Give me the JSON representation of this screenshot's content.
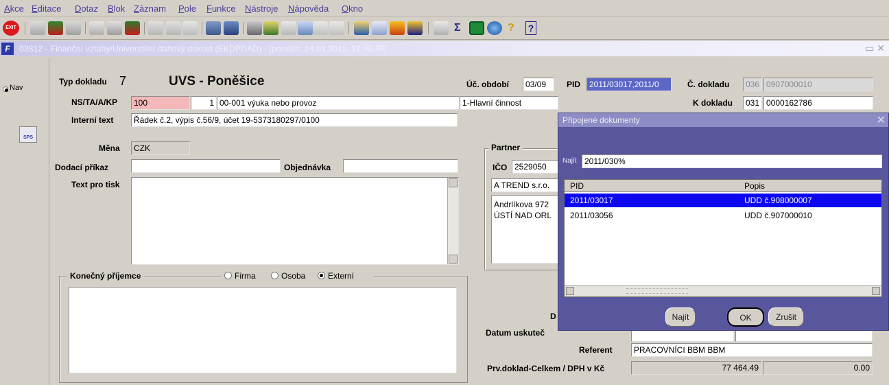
{
  "menu": [
    "Akce",
    "Editace",
    "Dotaz",
    "Blok",
    "Záznam",
    "Pole",
    "Funkce",
    "Nástroje",
    "Nápověda",
    "Okno"
  ],
  "toolbar": {
    "exit_label": "EXIT",
    "icons": [
      "exit-icon",
      "back-icon",
      "save-icon",
      "forward-icon",
      "copy-record-icon",
      "new-record-icon",
      "delete-record-icon",
      "sort-asc-icon",
      "sort-desc-icon",
      "filter-icon",
      "print-icon",
      "print-preview-icon",
      "cut-icon",
      "insert-icon",
      "paste-icon",
      "query-icon",
      "list-icon",
      "tree-icon",
      "export-icon",
      "document-icon",
      "star-icon",
      "warning-icon",
      "calculator-icon",
      "sum-icon",
      "excel-icon",
      "globe-icon",
      "help-icon",
      "context-help-icon"
    ],
    "sum_glyph": "Σ",
    "help_glyph": "?"
  },
  "window": {
    "title": "03812 - Finanční vztahy/Univerzální daňový doklad (EKDPDAD) - [pondělí, 24.01.2011, 12:45:36]",
    "controls": "▭ ✕"
  },
  "leftnav": {
    "nav_label": "Nav",
    "sps_label": "SPS"
  },
  "form": {
    "typ_dokladu_label": "Typ dokladu",
    "typ_dokladu_value": "7",
    "company": "UVS - Poněšice",
    "obdobi_label": "Úč. období",
    "obdobi_value": "03/09",
    "pid_label": "PID",
    "pid_value": "2011/03017,2011/0",
    "cdokladu_label": "Č. dokladu",
    "cdokladu_a": "036",
    "cdokladu_b": "0907000010",
    "ns_label": "NS/TA/A/KP",
    "ns_value": "100",
    "ta_num": "1",
    "ta_text": "00-001 výuka nebo provoz",
    "cinnost": "1-Hlavní činnost",
    "kdokladu_label": "K dokladu",
    "kdokladu_a": "031",
    "kdokladu_b": "0000162786",
    "interni_label": "Interní text",
    "interni_value": "Řádek č.2,  výpis č.56/9, účet 19-5373180297/0100",
    "mena_label": "Měna",
    "mena_value": "CZK",
    "dodaci_label": "Dodací příkaz",
    "dodaci_value": "",
    "objednavka_label": "Objednávka",
    "objednavka_value": "",
    "text_tisk_label": "Text pro tisk",
    "text_tisk_value": "",
    "partner_title": "Partner",
    "ico_label": "IČO",
    "ico_value": "2529050",
    "partner_name": "A TREND s.r.o.",
    "partner_addr1": "Andrlíkova 972",
    "partner_addr2": "ÚSTÍ NAD ORL",
    "konecny_title": "Konečný příjemce",
    "radio_firma": "Firma",
    "radio_osoba": "Osoba",
    "radio_externi": "Externí",
    "d_label": "D",
    "datum_label": "Datum uskuteč",
    "referent_label": "Referent",
    "referent_value": "PRACOVNÍCI BBM BBM",
    "prv_label": "Prv.doklad-Celkem / DPH v Kč",
    "prv_total": "77 464.49",
    "prv_dph": "0.00"
  },
  "dialog": {
    "title": "Připojené dokumenty",
    "search_label": "Najít",
    "search_value": "2011/030%",
    "columns": [
      "PID",
      "Popis"
    ],
    "rows": [
      {
        "pid": "2011/03017",
        "popis": "UDD č.908000007"
      },
      {
        "pid": "2011/03056",
        "popis": "UDD č.907000010"
      }
    ],
    "btn_najit": "Najít",
    "btn_ok": "OK",
    "btn_zrusit": "Zrušit"
  }
}
